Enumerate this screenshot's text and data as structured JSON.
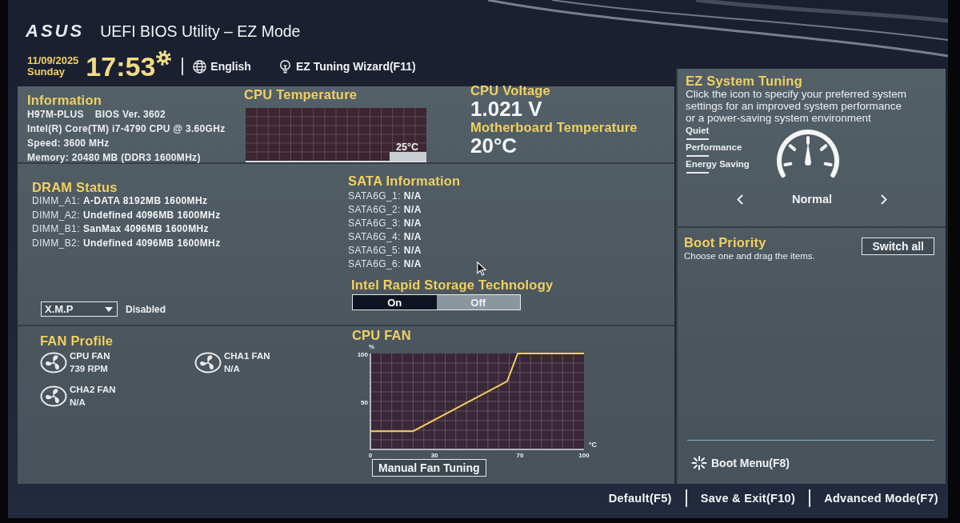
{
  "header": {
    "logo": "ASUS",
    "title": "UEFI BIOS Utility – EZ Mode",
    "date": "11/09/2025",
    "day": "Sunday",
    "time": "17:53",
    "language": "English",
    "tuning_wizard": "EZ Tuning Wizard(F11)"
  },
  "information": {
    "title": "Information",
    "model": "H97M-PLUS",
    "bios_version": "BIOS Ver. 3602",
    "lines": [
      "Intel(R) Core(TM) i7-4790 CPU @ 3.60GHz",
      "Speed: 3600 MHz",
      "Memory: 20480 MB (DDR3 1600MHz)"
    ]
  },
  "cpu_temperature": {
    "title": "CPU Temperature",
    "reading": "25°C"
  },
  "cpu_voltage": {
    "title": "CPU Voltage",
    "value": "1.021 V"
  },
  "motherboard_temperature": {
    "title": "Motherboard Temperature",
    "value": "20°C"
  },
  "dram_status": {
    "title": "DRAM Status",
    "slots": [
      {
        "label": "DIMM_A1:",
        "value": "A-DATA 8192MB 1600MHz"
      },
      {
        "label": "DIMM_A2:",
        "value": "Undefined 4096MB 1600MHz"
      },
      {
        "label": "DIMM_B1:",
        "value": "SanMax 4096MB 1600MHz"
      },
      {
        "label": "DIMM_B2:",
        "value": "Undefined 4096MB 1600MHz"
      }
    ]
  },
  "xmp": {
    "value": "X.M.P",
    "status": "Disabled"
  },
  "sata_information": {
    "title": "SATA Information",
    "ports": [
      {
        "label": "SATA6G_1:",
        "value": "N/A"
      },
      {
        "label": "SATA6G_2:",
        "value": "N/A"
      },
      {
        "label": "SATA6G_3:",
        "value": "N/A"
      },
      {
        "label": "SATA6G_4:",
        "value": "N/A"
      },
      {
        "label": "SATA6G_5:",
        "value": "N/A"
      },
      {
        "label": "SATA6G_6:",
        "value": "N/A"
      }
    ]
  },
  "intel_rapid_storage": {
    "title": "Intel Rapid Storage Technology",
    "options": [
      {
        "label": "On",
        "selected": true
      },
      {
        "label": "Off",
        "selected": false
      }
    ]
  },
  "fan_profile": {
    "title": "FAN Profile",
    "fans": [
      {
        "name": "CPU FAN",
        "reading": "739 RPM"
      },
      {
        "name": "CHA1 FAN",
        "reading": "N/A"
      },
      {
        "name": "CHA2 FAN",
        "reading": "N/A"
      }
    ]
  },
  "cpu_fan": {
    "chart_data": {
      "type": "line",
      "title": "CPU FAN",
      "xlabel": "°C",
      "ylabel": "%",
      "x": [
        0,
        20,
        64,
        69,
        100
      ],
      "values": [
        19,
        19,
        71,
        100,
        100
      ],
      "xlim": [
        0,
        100
      ],
      "ylim": [
        0,
        100
      ],
      "xticks": [
        0,
        30,
        70,
        100
      ],
      "yticks": [
        50,
        100
      ],
      "grid": true
    },
    "button": "Manual Fan Tuning"
  },
  "ez_system_tuning": {
    "title": "EZ System Tuning",
    "description": "Click the icon to specify your preferred system\nsettings for an improved system performance\nor a power-saving system environment",
    "profiles": [
      "Quiet",
      "Performance",
      "Energy Saving"
    ],
    "current": "Normal"
  },
  "boot_priority": {
    "title": "Boot Priority",
    "hint": "Choose one and drag the items.",
    "button": "Switch all"
  },
  "boot_menu": "Boot Menu(F8)",
  "bottom_bar": [
    "Default(F5)",
    "Save & Exit(F10)",
    "Advanced Mode(F7)"
  ]
}
